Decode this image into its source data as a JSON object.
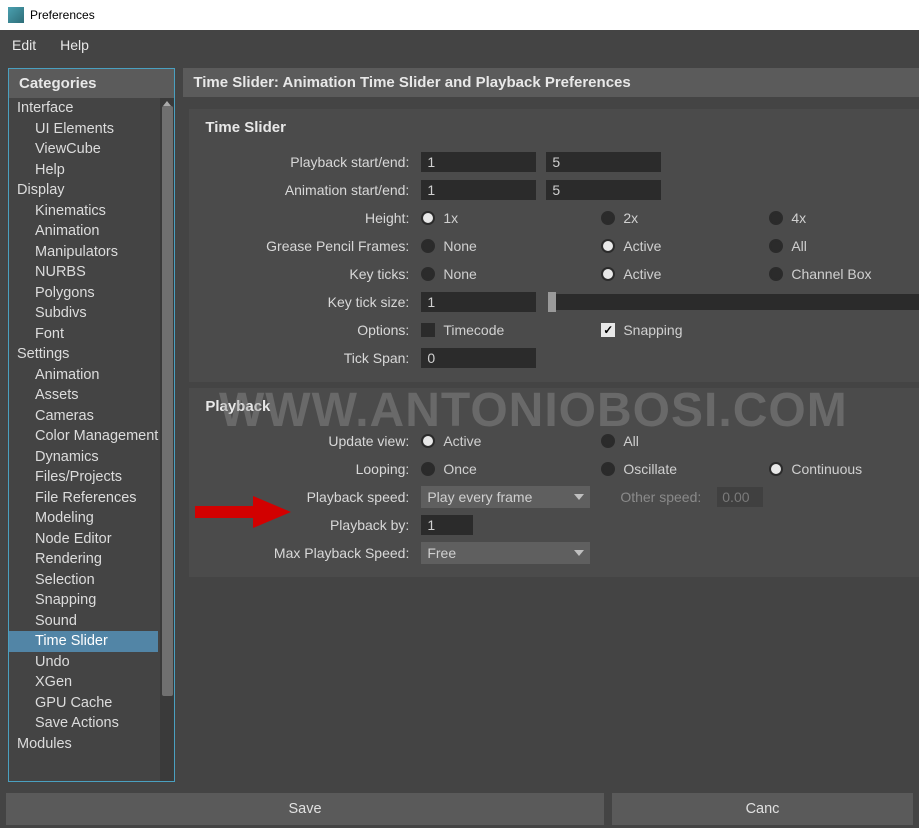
{
  "title": "Preferences",
  "menu": {
    "edit": "Edit",
    "help": "Help"
  },
  "sidebar": {
    "header": "Categories",
    "items": [
      {
        "label": "Interface",
        "child": false,
        "selected": false
      },
      {
        "label": "UI Elements",
        "child": true,
        "selected": false
      },
      {
        "label": "ViewCube",
        "child": true,
        "selected": false
      },
      {
        "label": "Help",
        "child": true,
        "selected": false
      },
      {
        "label": "Display",
        "child": false,
        "selected": false
      },
      {
        "label": "Kinematics",
        "child": true,
        "selected": false
      },
      {
        "label": "Animation",
        "child": true,
        "selected": false
      },
      {
        "label": "Manipulators",
        "child": true,
        "selected": false
      },
      {
        "label": "NURBS",
        "child": true,
        "selected": false
      },
      {
        "label": "Polygons",
        "child": true,
        "selected": false
      },
      {
        "label": "Subdivs",
        "child": true,
        "selected": false
      },
      {
        "label": "Font",
        "child": true,
        "selected": false
      },
      {
        "label": "Settings",
        "child": false,
        "selected": false
      },
      {
        "label": "Animation",
        "child": true,
        "selected": false
      },
      {
        "label": "Assets",
        "child": true,
        "selected": false
      },
      {
        "label": "Cameras",
        "child": true,
        "selected": false
      },
      {
        "label": "Color Management",
        "child": true,
        "selected": false
      },
      {
        "label": "Dynamics",
        "child": true,
        "selected": false
      },
      {
        "label": "Files/Projects",
        "child": true,
        "selected": false
      },
      {
        "label": "File References",
        "child": true,
        "selected": false
      },
      {
        "label": "Modeling",
        "child": true,
        "selected": false
      },
      {
        "label": "Node Editor",
        "child": true,
        "selected": false
      },
      {
        "label": "Rendering",
        "child": true,
        "selected": false
      },
      {
        "label": "Selection",
        "child": true,
        "selected": false
      },
      {
        "label": "Snapping",
        "child": true,
        "selected": false
      },
      {
        "label": "Sound",
        "child": true,
        "selected": false
      },
      {
        "label": "Time Slider",
        "child": true,
        "selected": true
      },
      {
        "label": "Undo",
        "child": true,
        "selected": false
      },
      {
        "label": "XGen",
        "child": true,
        "selected": false
      },
      {
        "label": "GPU Cache",
        "child": true,
        "selected": false
      },
      {
        "label": "Save Actions",
        "child": true,
        "selected": false
      },
      {
        "label": "Modules",
        "child": false,
        "selected": false
      }
    ]
  },
  "content": {
    "header": "Time Slider: Animation Time Slider and Playback Preferences",
    "time_slider": {
      "title": "Time Slider",
      "playback_se_label": "Playback start/end:",
      "playback_start": "1",
      "playback_end": "5",
      "anim_se_label": "Animation start/end:",
      "anim_start": "1",
      "anim_end": "5",
      "height_label": "Height:",
      "height_opts": [
        "1x",
        "2x",
        "4x"
      ],
      "height_sel": 0,
      "grease_label": "Grease Pencil Frames:",
      "grease_opts": [
        "None",
        "Active",
        "All"
      ],
      "grease_sel": 1,
      "keyticks_label": "Key ticks:",
      "keyticks_opts": [
        "None",
        "Active",
        "Channel Box"
      ],
      "keyticks_sel": 1,
      "keytick_size_label": "Key tick size:",
      "keytick_size": "1",
      "options_label": "Options:",
      "opt_timecode": "Timecode",
      "opt_snapping": "Snapping",
      "tickspan_label": "Tick Span:",
      "tickspan": "0"
    },
    "playback": {
      "title": "Playback",
      "update_label": "Update view:",
      "update_opts": [
        "Active",
        "All"
      ],
      "update_sel": 0,
      "loop_label": "Looping:",
      "loop_opts": [
        "Once",
        "Oscillate",
        "Continuous"
      ],
      "loop_sel": 2,
      "speed_label": "Playback speed:",
      "speed_value": "Play every frame",
      "other_speed_label": "Other speed:",
      "other_speed": "0.00",
      "by_label": "Playback by:",
      "by_value": "1",
      "max_label": "Max Playback Speed:",
      "max_value": "Free"
    }
  },
  "buttons": {
    "save": "Save",
    "cancel": "Canc"
  },
  "watermark": "WWW.ANTONIOBOSI.COM"
}
